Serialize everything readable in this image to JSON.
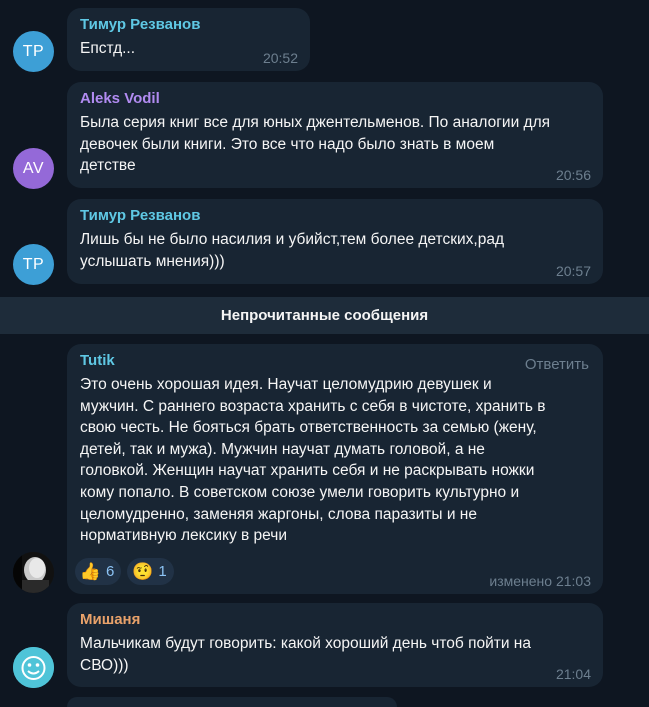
{
  "messages": [
    {
      "avatar": "ТР",
      "name": "Тимур Резванов",
      "text": "Епстд...",
      "time": "20:52"
    },
    {
      "avatar": "AV",
      "name": "Aleks Vodil",
      "lines": [
        "Была серия книг все для юных джентельменов. По аналогии для",
        "девочек были книги. Это все что надо было знать в моем",
        "детстве"
      ],
      "time": "20:56"
    },
    {
      "avatar": "ТР",
      "name": "Тимур Резванов",
      "lines": [
        "Лишь бы не было насилия и убийст,тем более детских,рад",
        "услышать мнения)))"
      ],
      "time": "20:57"
    },
    {
      "name": "Tutik",
      "reply_label": "Ответить",
      "lines": [
        "Это очень хорошая идея. Научат целомудрию девушек и",
        "мужчин. С раннего возраста хранить с себя в чистоте, хранить в",
        "свою честь. Не бояться брать ответственность за семью (жену,",
        "детей, так и мужа). Мужчин научат думать головой, а не",
        "головкой. Женщин научат хранить себя и не раскрывать ножки",
        "кому попало. В советском союзе умели говорить культурно и",
        "целомудренно, заменяя жаргоны, слова паразиты и не",
        "нормативную лексику в речи"
      ],
      "reactions": [
        {
          "emoji": "👍",
          "icon": "thumbs-up-icon",
          "count": "6"
        },
        {
          "emoji": "🤨",
          "icon": "raised-eyebrow-icon",
          "count": "1"
        }
      ],
      "time": "изменено 21:03"
    },
    {
      "name": "Мишаня",
      "lines": [
        "Мальчикам будут говорить: какой хороший день чтоб пойти на",
        "СВО)))"
      ],
      "time": "21:04"
    }
  ],
  "divider": "Непрочитанные сообщения",
  "colors": {
    "background": "#0e1621",
    "bubble": "#182533",
    "divider_bg": "#1e2c3a",
    "name_timur": "#5fc8e4",
    "name_aleks": "#b18bf1",
    "name_tutik": "#5fc8e4",
    "name_mishanya": "#e9a26a",
    "avatar_blue": "#3d9fd6",
    "avatar_purple": "#9469d8",
    "meta": "#6d7f8f"
  }
}
